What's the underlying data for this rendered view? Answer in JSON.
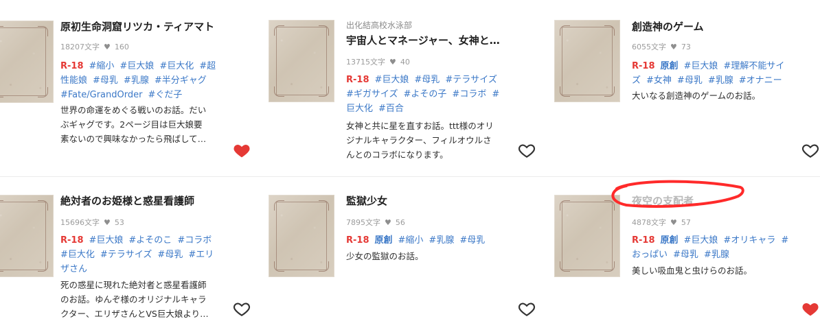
{
  "cards": [
    {
      "title": "原初生命洞窟リツカ・ティアマト",
      "chars": "18207文字",
      "likes": "160",
      "tags_line1": [
        "R-18",
        "#縮小",
        "#巨大娘",
        "#巨大化",
        "#超"
      ],
      "tags_line2": [
        "性能娘",
        "#母乳",
        "#乳腺",
        "#半分ギャグ"
      ],
      "tags_line3": [
        "#Fate/GrandOrder",
        "#ぐだ子"
      ],
      "desc_lines": [
        "世界の命運をめぐる戦いのお話。だい",
        "ぶギャグです。2ページ目は巨大娘要",
        "素ないので興味なかったら飛ばして…"
      ],
      "favorite": "filled"
    },
    {
      "series": "出化結高校水泳部",
      "title": "宇宙人とマネージャー、女神と…",
      "chars": "13715文字",
      "likes": "40",
      "tags_line1": [
        "R-18",
        "#巨大娘",
        "#母乳",
        "#テラサイズ"
      ],
      "tags_line2": [
        "#ギガサイズ",
        "#よその子",
        "#コラボ",
        "#"
      ],
      "tags_line3": [
        "巨大化",
        "#百合"
      ],
      "desc_lines": [
        "女神と共に星を直すお話。ttt様のオリ",
        "ジナルキャラクター、フィルオウルさ",
        "んとのコラボになります。"
      ],
      "favorite": "outline"
    },
    {
      "title": "創造神のゲーム",
      "chars": "6055文字",
      "likes": "73",
      "tags_line1": [
        "R-18",
        "原創",
        "#巨大娘",
        "#理解不能サイ"
      ],
      "tags_line2": [
        "ズ",
        "#女神",
        "#母乳",
        "#乳腺",
        "#オナニー"
      ],
      "desc_lines": [
        "大いなる創造神のゲームのお話。"
      ],
      "favorite": "outline"
    },
    {
      "title": "絶対者のお姫様と惑星看護師",
      "chars": "15696文字",
      "likes": "53",
      "tags_line1": [
        "R-18",
        "#巨大娘",
        "#よそのこ",
        "#コラボ"
      ],
      "tags_line2": [
        "#巨大化",
        "#テラサイズ",
        "#母乳",
        "#エリ"
      ],
      "tags_line3": [
        "ザさん"
      ],
      "desc_lines": [
        "死の惑星に現れた絶対者と惑星看護師",
        "のお話。ゆんぞ様のオリジナルキャラ",
        "クター、エリザさんとVS巨大娘より…"
      ],
      "favorite": "outline"
    },
    {
      "title": "監獄少女",
      "chars": "7895文字",
      "likes": "56",
      "tags_line1": [
        "R-18",
        "原創",
        "#縮小",
        "#乳腺",
        "#母乳"
      ],
      "desc_lines": [
        "少女の監獄のお話。"
      ],
      "favorite": "outline"
    },
    {
      "title": "夜空の支配者",
      "chars": "4878文字",
      "likes": "57",
      "tags_line1": [
        "R-18",
        "原創",
        "#巨大娘",
        "#オリキャラ",
        "#"
      ],
      "tags_line2": [
        "おっぱい",
        "#母乳",
        "#乳腺"
      ],
      "desc_lines": [
        "美しい吸血鬼と虫けらのお話。"
      ],
      "favorite": "filled"
    }
  ]
}
